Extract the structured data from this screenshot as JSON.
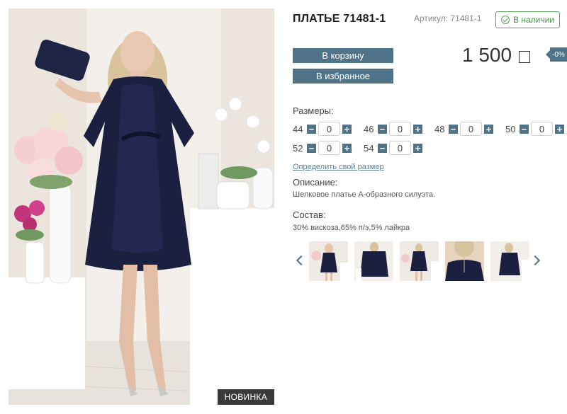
{
  "product": {
    "title": "ПЛАТЬЕ 71481-1",
    "article": "Артикул: 71481-1",
    "stock": "В наличии",
    "price": "1 500",
    "discount": "-0%",
    "badge": "НОВИНКА"
  },
  "buttons": {
    "cart": "В корзину",
    "favorite": "В избранное"
  },
  "sizes": {
    "label": "Размеры:",
    "items": [
      {
        "size": "44",
        "qty": "0"
      },
      {
        "size": "46",
        "qty": "0"
      },
      {
        "size": "48",
        "qty": "0"
      },
      {
        "size": "50",
        "qty": "0"
      },
      {
        "size": "52",
        "qty": "0"
      },
      {
        "size": "54",
        "qty": "0"
      }
    ],
    "minus": "−",
    "plus": "+",
    "size_link": "Определить свой размер"
  },
  "description": {
    "label": "Описание:",
    "text": "Шелковое платье А-образного силуэта."
  },
  "composition": {
    "label": "Состав:",
    "text": "30% вискоза,65% п/э,5% лайкра"
  },
  "colors": {
    "accent": "#4f7388",
    "stock_green": "#58a05a",
    "dress": "#1c2040"
  },
  "icons": {
    "stock": "check-circle-icon",
    "currency": "currency-box-icon",
    "gallery_prev": "chevron-left-icon",
    "gallery_next": "chevron-right-icon"
  }
}
